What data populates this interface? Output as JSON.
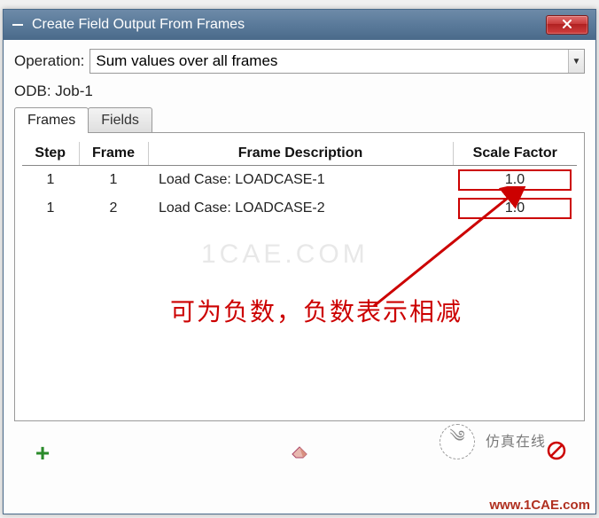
{
  "window": {
    "title": "Create Field Output From Frames"
  },
  "operation": {
    "label": "Operation:",
    "value": "Sum values over all frames"
  },
  "odb": {
    "label": "ODB:",
    "value": "Job-1"
  },
  "tabs": {
    "frames": "Frames",
    "fields": "Fields",
    "active": "frames"
  },
  "table": {
    "headers": {
      "step": "Step",
      "frame": "Frame",
      "desc": "Frame Description",
      "scale": "Scale Factor"
    },
    "rows": [
      {
        "step": "1",
        "frame": "1",
        "desc": "Load Case: LOADCASE-1",
        "scale": "1.0"
      },
      {
        "step": "1",
        "frame": "2",
        "desc": "Load Case: LOADCASE-2",
        "scale": "1.0"
      }
    ]
  },
  "annotation": "可为负数，负数表示相减",
  "watermarks": {
    "center": "1CAE.COM",
    "brand": "仿真在线",
    "site": "www.1CAE.com"
  },
  "icons": {
    "app": "app-icon",
    "close": "close-icon",
    "add": "add-icon",
    "erase": "erase-icon",
    "delete": "no-icon"
  }
}
